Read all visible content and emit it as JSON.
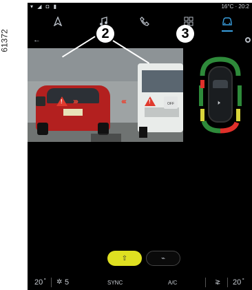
{
  "ref_number": "61372",
  "status": {
    "left_icons": "▾ ◢ ◘ ▮",
    "temperature_time": "16°C · 20:2"
  },
  "nav": {
    "items": [
      {
        "icon": "navigation-arrow-icon",
        "glyph": "⮝"
      },
      {
        "icon": "music-note-icon",
        "glyph": "♫"
      },
      {
        "icon": "phone-icon",
        "glyph": "✆"
      },
      {
        "icon": "apps-grid-icon",
        "glyph": "▦"
      },
      {
        "icon": "car-icon",
        "glyph": "⛟"
      }
    ]
  },
  "camera": {
    "warning_symbol": "!",
    "left_chevrons": "›››",
    "right_chevrons": "‹‹‹",
    "rcta_label": "OFF"
  },
  "callouts": {
    "two": "2",
    "three": "3"
  },
  "sensor": {
    "mute_icon": "🕨"
  },
  "buttons": {
    "rear_camera_icon": "⇧",
    "front_camera_icon": "⌁"
  },
  "bottom": {
    "left_temp": "20 ̊",
    "fan_level": "5",
    "sync": "SYNC",
    "ac": "A/C",
    "right_temp": "20 ̊"
  },
  "colors": {
    "accent": "#3aa0e0",
    "warning": "#e03a2e",
    "camera_button": "#dfe021",
    "sensor_green": "#2e8a3a",
    "sensor_yellow": "#d8d43a",
    "sensor_red": "#e0302a"
  }
}
